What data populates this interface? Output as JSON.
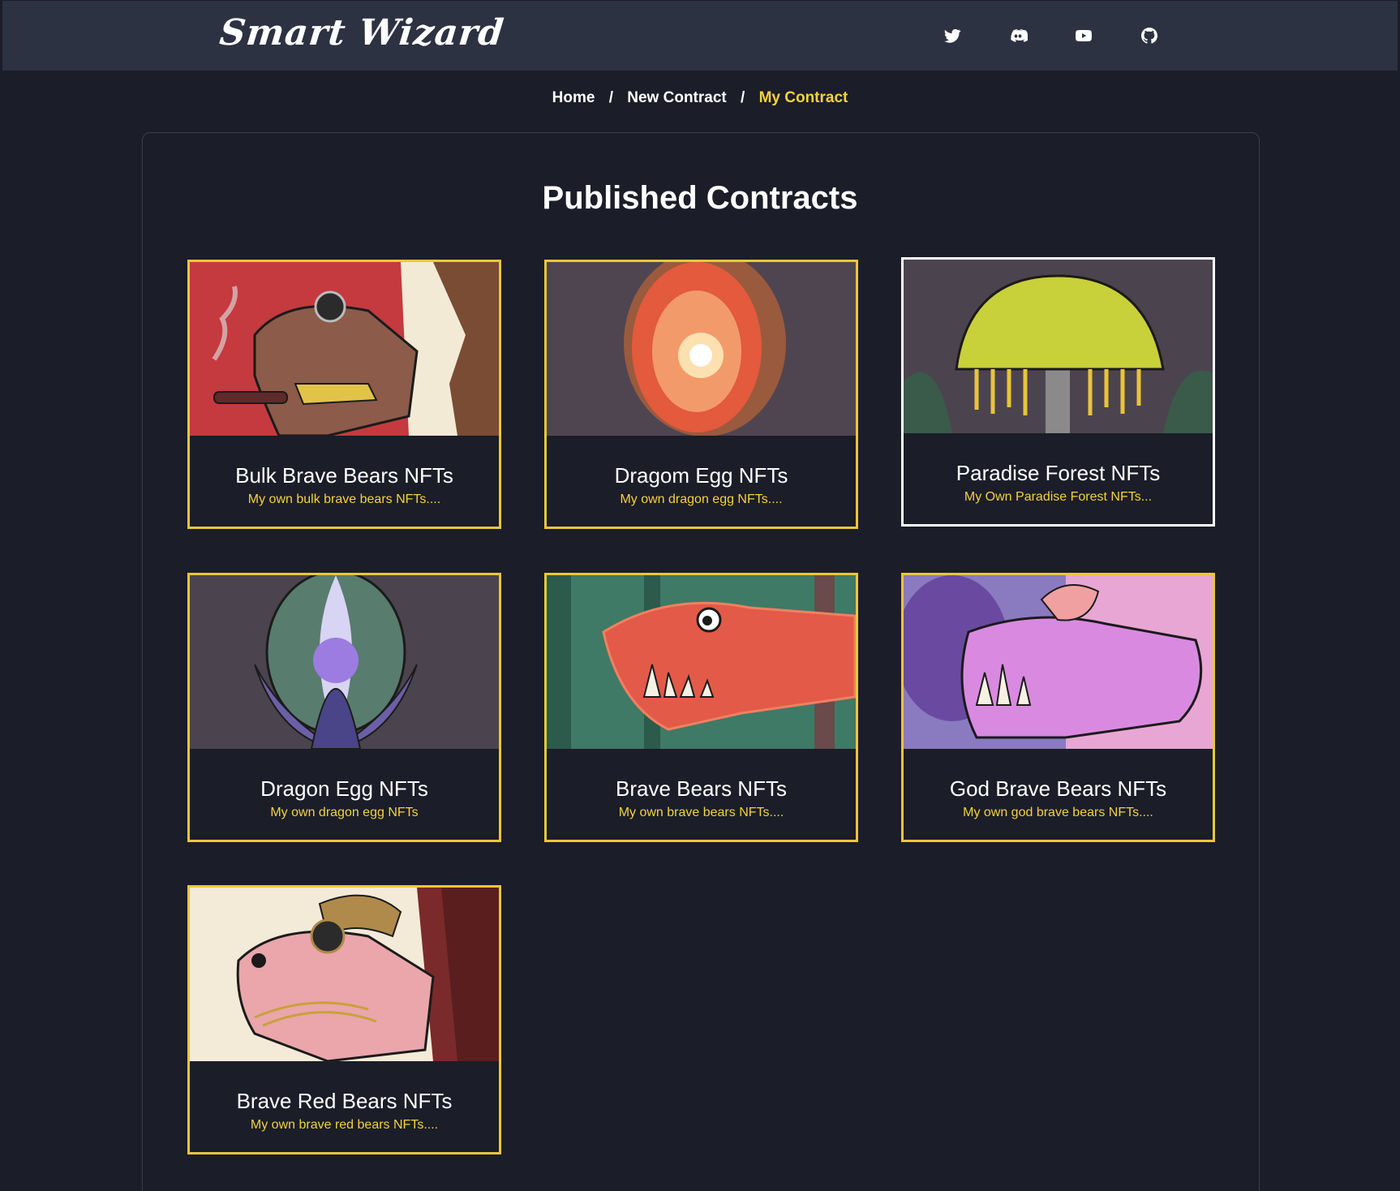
{
  "header": {
    "logo": "Smart Wizard",
    "social": [
      {
        "name": "twitter-icon"
      },
      {
        "name": "discord-icon"
      },
      {
        "name": "youtube-icon"
      },
      {
        "name": "github-icon"
      }
    ]
  },
  "breadcrumb": {
    "items": [
      "Home",
      "New Contract",
      "My Contract"
    ],
    "separator": "/"
  },
  "main": {
    "title": "Published Contracts",
    "cards": [
      {
        "title": "Bulk Brave Bears NFTs",
        "desc": "My own bulk brave bears NFTs...."
      },
      {
        "title": "Dragom Egg NFTs",
        "desc": "My own dragon egg NFTs...."
      },
      {
        "title": "Paradise Forest NFTs",
        "desc": "My Own Paradise Forest NFTs..."
      },
      {
        "title": "Dragon Egg NFTs",
        "desc": "My own dragon egg NFTs"
      },
      {
        "title": "Brave Bears NFTs",
        "desc": "My own brave bears NFTs...."
      },
      {
        "title": "God Brave Bears NFTs",
        "desc": "My own god brave bears NFTs...."
      },
      {
        "title": "Brave Red Bears NFTs",
        "desc": "My own brave red bears NFTs...."
      }
    ]
  },
  "colors": {
    "background": "#1b1d28",
    "header": "#2c3242",
    "accent": "#f4d23c",
    "card_border": "#e8c73a"
  }
}
